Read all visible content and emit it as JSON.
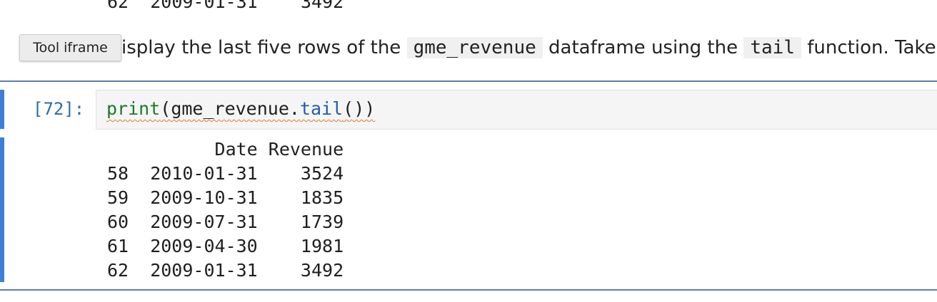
{
  "prev_output": {
    "row_label": "62",
    "date": "2009-01-31",
    "revenue": "3492"
  },
  "tooltip": "Tool iframe",
  "markdown": {
    "part1": "isplay the last five rows of the ",
    "code1": "gme_revenue",
    "part2": " dataframe using the ",
    "code2": "tail",
    "part3": " function. Take"
  },
  "cell": {
    "prompt": "[72]:",
    "code_builtin": "print",
    "code_open": "(gme_revenue.",
    "code_method": "tail",
    "code_close": "())"
  },
  "output": {
    "header": "          Date Revenue",
    "rows": [
      "58  2010-01-31    3524",
      "59  2009-10-31    1835",
      "60  2009-07-31    1739",
      "61  2009-04-30    1981",
      "62  2009-01-31    3492"
    ]
  }
}
